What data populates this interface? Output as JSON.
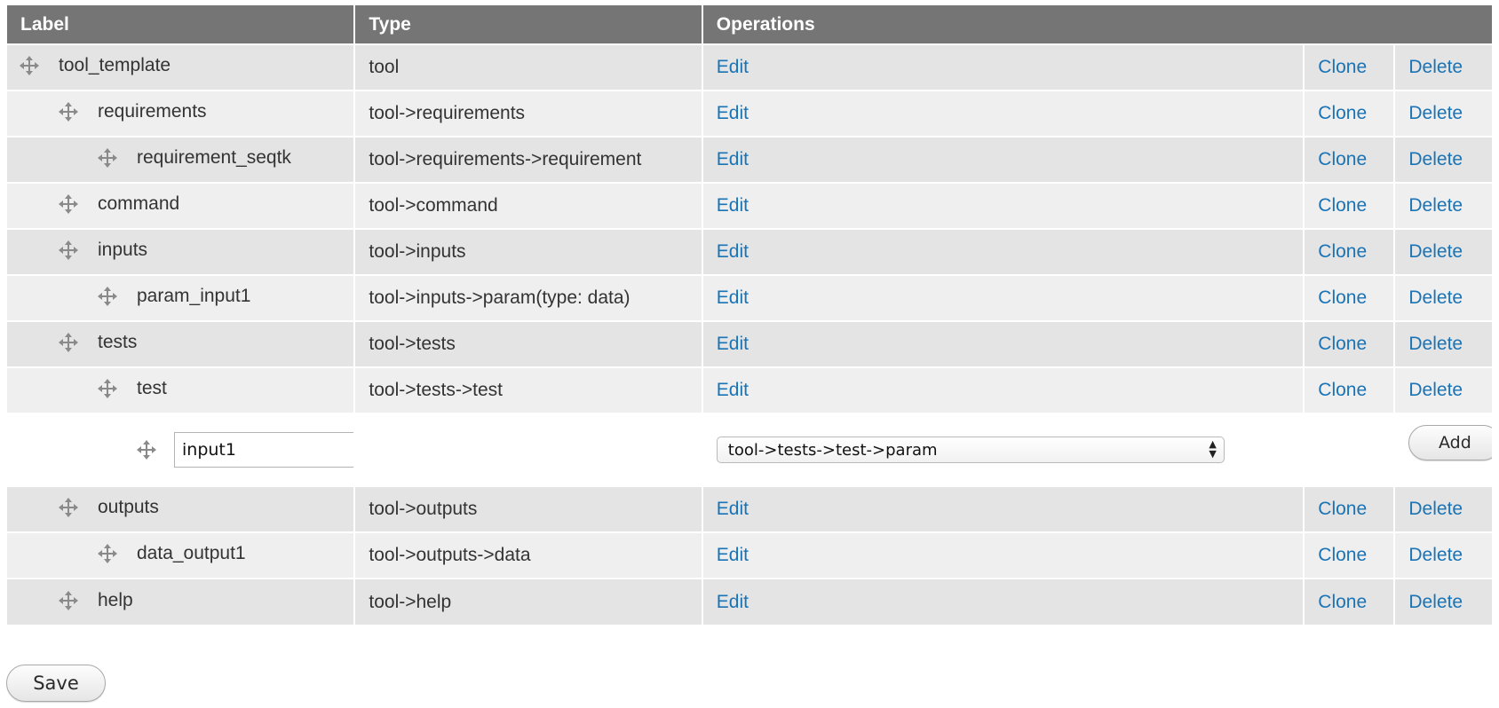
{
  "table": {
    "headers": {
      "label": "Label",
      "type": "Type",
      "operations": "Operations"
    },
    "operations": {
      "edit": "Edit",
      "clone": "Clone",
      "delete": "Delete"
    },
    "rows_top": [
      {
        "label": "tool_template",
        "type": "tool",
        "level": 0
      },
      {
        "label": "requirements",
        "type": "tool->requirements",
        "level": 1
      },
      {
        "label": "requirement_seqtk",
        "type": "tool->requirements->requirement",
        "level": 2
      },
      {
        "label": "command",
        "type": "tool->command",
        "level": 1
      },
      {
        "label": "inputs",
        "type": "tool->inputs",
        "level": 1
      },
      {
        "label": "param_input1",
        "type": "tool->inputs->param(type: data)",
        "level": 2
      },
      {
        "label": "tests",
        "type": "tool->tests",
        "level": 1
      },
      {
        "label": "test",
        "type": "tool->tests->test",
        "level": 2
      }
    ],
    "add_row": {
      "input_value": "input1",
      "select_value": "tool->tests->test->param",
      "add_label": "Add"
    },
    "rows_bottom": [
      {
        "label": "outputs",
        "type": "tool->outputs",
        "level": 1
      },
      {
        "label": "data_output1",
        "type": "tool->outputs->data",
        "level": 2
      },
      {
        "label": "help",
        "type": "tool->help",
        "level": 1
      }
    ]
  },
  "save_label": "Save",
  "colors": {
    "header_bg": "#757575",
    "row_odd": "#e4e4e4",
    "row_even": "#efefef",
    "link": "#1a73b5"
  },
  "icons": {
    "drag": "move-arrows-icon"
  }
}
